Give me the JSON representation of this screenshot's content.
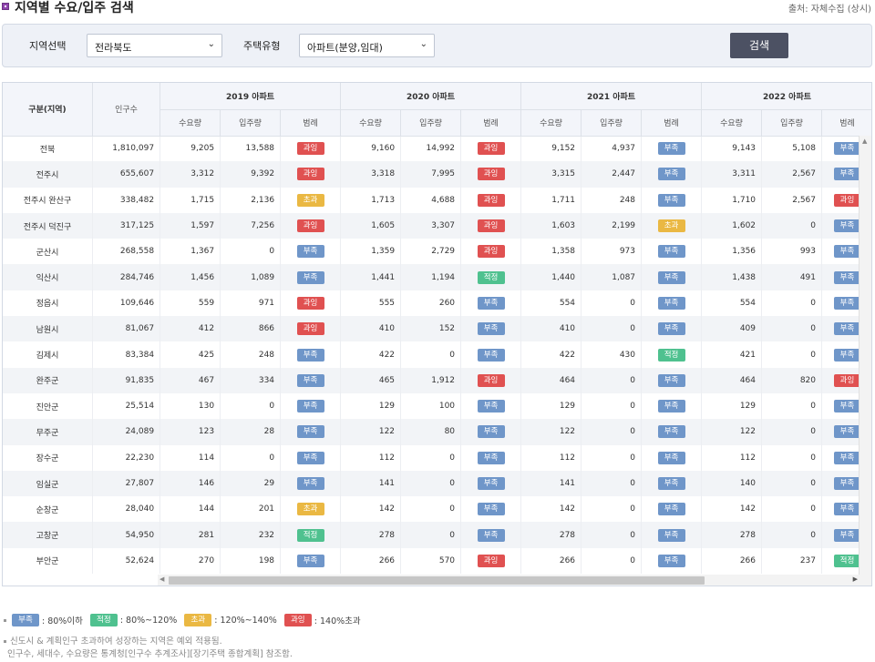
{
  "header": {
    "title": "지역별 수요/입주 검색",
    "source": "출처: 자체수집 (상시)"
  },
  "search": {
    "region_label": "지역선택",
    "region_value": "전라북도",
    "type_label": "주택유형",
    "type_value": "아파트(분양,임대)",
    "button_label": "검색"
  },
  "table": {
    "col_region": "구분(지역)",
    "col_population": "인구수",
    "years": [
      "2019 아파트",
      "2020 아파트",
      "2021 아파트",
      "2022 아파트"
    ],
    "sub_headers": [
      "수요량",
      "입주량",
      "범례"
    ],
    "rows": [
      {
        "region": "전북",
        "pop": "1,810,097",
        "y": [
          [
            "9,205",
            "13,588",
            "과잉"
          ],
          [
            "9,160",
            "14,992",
            "과잉"
          ],
          [
            "9,152",
            "4,937",
            "부족"
          ],
          [
            "9,143",
            "5,108",
            "부족"
          ]
        ]
      },
      {
        "region": "전주시",
        "pop": "655,607",
        "y": [
          [
            "3,312",
            "9,392",
            "과잉"
          ],
          [
            "3,318",
            "7,995",
            "과잉"
          ],
          [
            "3,315",
            "2,447",
            "부족"
          ],
          [
            "3,311",
            "2,567",
            "부족"
          ]
        ]
      },
      {
        "region": "전주시 완산구",
        "pop": "338,482",
        "y": [
          [
            "1,715",
            "2,136",
            "초과"
          ],
          [
            "1,713",
            "4,688",
            "과잉"
          ],
          [
            "1,711",
            "248",
            "부족"
          ],
          [
            "1,710",
            "2,567",
            "과잉"
          ]
        ]
      },
      {
        "region": "전주시 덕진구",
        "pop": "317,125",
        "y": [
          [
            "1,597",
            "7,256",
            "과잉"
          ],
          [
            "1,605",
            "3,307",
            "과잉"
          ],
          [
            "1,603",
            "2,199",
            "초과"
          ],
          [
            "1,602",
            "0",
            "부족"
          ]
        ]
      },
      {
        "region": "군산시",
        "pop": "268,558",
        "y": [
          [
            "1,367",
            "0",
            "부족"
          ],
          [
            "1,359",
            "2,729",
            "과잉"
          ],
          [
            "1,358",
            "973",
            "부족"
          ],
          [
            "1,356",
            "993",
            "부족"
          ]
        ]
      },
      {
        "region": "익산시",
        "pop": "284,746",
        "y": [
          [
            "1,456",
            "1,089",
            "부족"
          ],
          [
            "1,441",
            "1,194",
            "적정"
          ],
          [
            "1,440",
            "1,087",
            "부족"
          ],
          [
            "1,438",
            "491",
            "부족"
          ]
        ]
      },
      {
        "region": "정읍시",
        "pop": "109,646",
        "y": [
          [
            "559",
            "971",
            "과잉"
          ],
          [
            "555",
            "260",
            "부족"
          ],
          [
            "554",
            "0",
            "부족"
          ],
          [
            "554",
            "0",
            "부족"
          ]
        ]
      },
      {
        "region": "남원시",
        "pop": "81,067",
        "y": [
          [
            "412",
            "866",
            "과잉"
          ],
          [
            "410",
            "152",
            "부족"
          ],
          [
            "410",
            "0",
            "부족"
          ],
          [
            "409",
            "0",
            "부족"
          ]
        ]
      },
      {
        "region": "김제시",
        "pop": "83,384",
        "y": [
          [
            "425",
            "248",
            "부족"
          ],
          [
            "422",
            "0",
            "부족"
          ],
          [
            "422",
            "430",
            "적정"
          ],
          [
            "421",
            "0",
            "부족"
          ]
        ]
      },
      {
        "region": "완주군",
        "pop": "91,835",
        "y": [
          [
            "467",
            "334",
            "부족"
          ],
          [
            "465",
            "1,912",
            "과잉"
          ],
          [
            "464",
            "0",
            "부족"
          ],
          [
            "464",
            "820",
            "과잉"
          ]
        ]
      },
      {
        "region": "진안군",
        "pop": "25,514",
        "y": [
          [
            "130",
            "0",
            "부족"
          ],
          [
            "129",
            "100",
            "부족"
          ],
          [
            "129",
            "0",
            "부족"
          ],
          [
            "129",
            "0",
            "부족"
          ]
        ]
      },
      {
        "region": "무주군",
        "pop": "24,089",
        "y": [
          [
            "123",
            "28",
            "부족"
          ],
          [
            "122",
            "80",
            "부족"
          ],
          [
            "122",
            "0",
            "부족"
          ],
          [
            "122",
            "0",
            "부족"
          ]
        ]
      },
      {
        "region": "장수군",
        "pop": "22,230",
        "y": [
          [
            "114",
            "0",
            "부족"
          ],
          [
            "112",
            "0",
            "부족"
          ],
          [
            "112",
            "0",
            "부족"
          ],
          [
            "112",
            "0",
            "부족"
          ]
        ]
      },
      {
        "region": "임실군",
        "pop": "27,807",
        "y": [
          [
            "146",
            "29",
            "부족"
          ],
          [
            "141",
            "0",
            "부족"
          ],
          [
            "141",
            "0",
            "부족"
          ],
          [
            "140",
            "0",
            "부족"
          ]
        ]
      },
      {
        "region": "순창군",
        "pop": "28,040",
        "y": [
          [
            "144",
            "201",
            "초과"
          ],
          [
            "142",
            "0",
            "부족"
          ],
          [
            "142",
            "0",
            "부족"
          ],
          [
            "142",
            "0",
            "부족"
          ]
        ]
      },
      {
        "region": "고창군",
        "pop": "54,950",
        "y": [
          [
            "281",
            "232",
            "적정"
          ],
          [
            "278",
            "0",
            "부족"
          ],
          [
            "278",
            "0",
            "부족"
          ],
          [
            "278",
            "0",
            "부족"
          ]
        ]
      },
      {
        "region": "부안군",
        "pop": "52,624",
        "y": [
          [
            "270",
            "198",
            "부족"
          ],
          [
            "266",
            "570",
            "과잉"
          ],
          [
            "266",
            "0",
            "부족"
          ],
          [
            "266",
            "237",
            "적정"
          ]
        ]
      }
    ]
  },
  "legend": {
    "items": [
      {
        "badge": "부족",
        "text": ": 80%이하",
        "color": "#6f96c9"
      },
      {
        "badge": "적정",
        "text": ": 80%~120%",
        "color": "#4fc18f"
      },
      {
        "badge": "초과",
        "text": ": 120%~140%",
        "color": "#eab843"
      },
      {
        "badge": "과잉",
        "text": ": 140%초과",
        "color": "#e05151"
      }
    ]
  },
  "notes": {
    "line1": "신도시 & 계획인구 초과하여 성장하는 지역은 예외 적용됨.",
    "line2": "인구수, 세대수, 수요량은 통계청[인구수 추계조사][장기주택 종합계획] 참조함."
  },
  "icons": {
    "dropdown": "chevron-down-icon",
    "scroll_up": "arrow-up-icon",
    "scroll_left": "arrow-left-icon",
    "scroll_right": "arrow-right-icon",
    "title_marker": "square-bullet-icon"
  }
}
